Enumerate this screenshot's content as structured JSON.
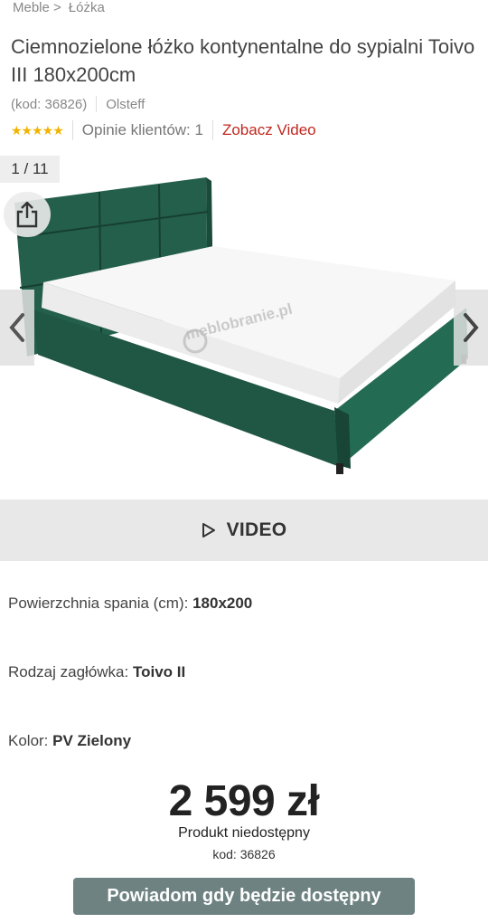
{
  "breadcrumb": {
    "items": [
      "Meble >",
      "Łóżka"
    ]
  },
  "product": {
    "title": "Ciemnozielone łóżko kontynentalne do sypialni Toivo III 180x200cm",
    "code_label": "(kod: 36826)",
    "brand": "Olsteff",
    "stars": "★★★★★",
    "reviews": "Opinie klientów: 1",
    "video_link": "Zobacz Video"
  },
  "gallery": {
    "counter": "1 / 11",
    "watermark": "meblobranie.pl",
    "share_icon": "share-icon",
    "prev_icon": "chevron-left-icon",
    "next_icon": "chevron-right-icon"
  },
  "video_bar": {
    "label": "VIDEO",
    "icon": "play-outline-icon"
  },
  "specs": [
    {
      "label": "Powierzchnia spania (cm): ",
      "value": "180x200"
    },
    {
      "label": "Rodzaj zagłówka: ",
      "value": "Toivo II"
    },
    {
      "label": "Kolor: ",
      "value": "PV Zielony"
    }
  ],
  "price": {
    "amount": "2 599 zł",
    "availability": "Produkt niedostępny",
    "code": "kod: 36826"
  },
  "notify_button": {
    "label": "Powiadom gdy będzie dostępny"
  },
  "colors": {
    "accent_red": "#c0281f",
    "bed_green": "#1f5c47",
    "button": "#6e8282",
    "star": "#f0b400"
  }
}
